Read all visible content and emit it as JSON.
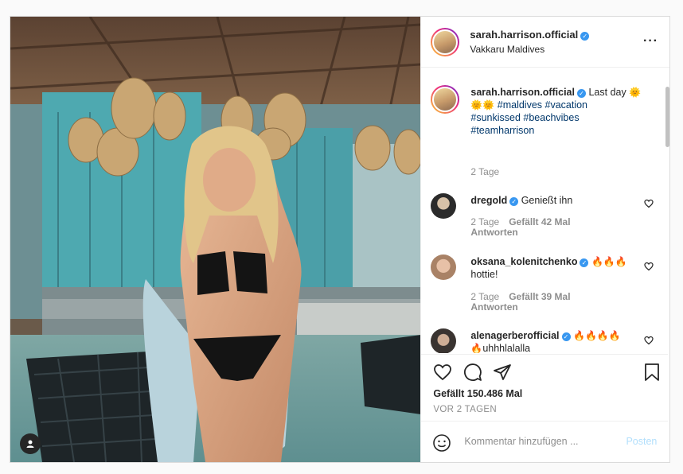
{
  "post": {
    "username": "sarah.harrison.official",
    "location": "Vakkaru Maldives"
  },
  "caption": {
    "username": "sarah.harrison.official",
    "text": "Last day",
    "emojis": "🌞🌞🌞",
    "hashtags_line1": "#maldives #vacation",
    "hashtags_line2": "#sunkissed #beachvibes",
    "hashtags_line3": "#teamharrison",
    "age": "2 Tage"
  },
  "comments": [
    {
      "username": "dregold",
      "text": "Genießt ihn",
      "age": "2 Tage",
      "likes": "Gefällt 42 Mal",
      "reply": "Antworten"
    },
    {
      "username": "oksana_kolenitchenko",
      "text": "hottie!",
      "emojis": "🔥🔥🔥",
      "age": "2 Tage",
      "likes": "Gefällt 39 Mal",
      "reply": "Antworten"
    },
    {
      "username": "alenagerberofficial",
      "emojis": "🔥🔥🔥🔥",
      "text": "uhhhlalalla",
      "text_emoji": "🔥"
    }
  ],
  "stats": {
    "likes": "Gefällt 150.486 Mal",
    "date": "VOR 2 TAGEN"
  },
  "comment_box": {
    "placeholder": "Kommentar hinzufügen ...",
    "post_label": "Posten"
  },
  "icons": {
    "heart": "heart-icon",
    "comment": "comment-icon",
    "share": "share-icon",
    "save": "bookmark-icon",
    "more": "more-options-icon",
    "emoji": "emoji-icon",
    "user_tag": "user-tag-icon"
  },
  "colors": {
    "verified": "#3897f0",
    "link": "#00376b",
    "muted": "#8e8e8e",
    "post_disabled": "#b2dffc"
  }
}
